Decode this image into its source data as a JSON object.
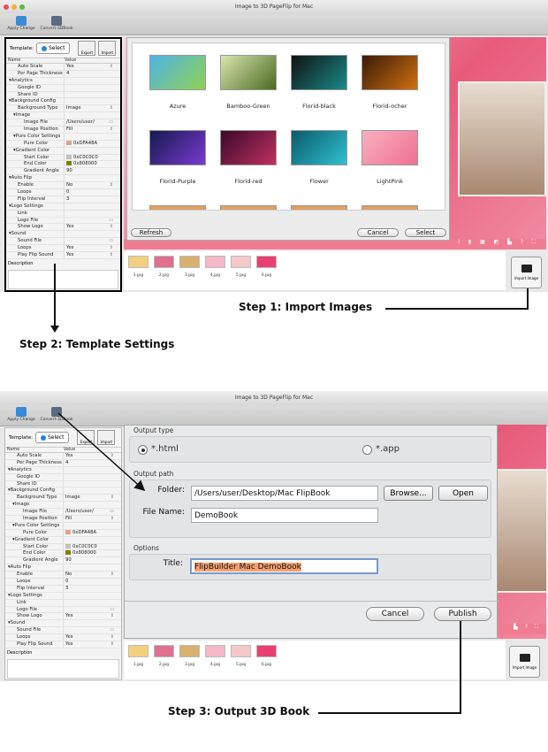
{
  "app": {
    "title": "Image to 3D PageFlip for Mac",
    "toolbar": {
      "apply": "Apply Change",
      "convert": "Convert-3DBook"
    }
  },
  "panel": {
    "template_label": "Template:",
    "select": "Select",
    "export": "Export",
    "import": "Import",
    "col_name": "Name",
    "col_value": "Value",
    "description": "Description",
    "rows": [
      {
        "n": "Auto Scale",
        "v": "Yes",
        "lvl": 2,
        "ctl": "dropdown"
      },
      {
        "n": "Per Page Thickness",
        "v": "4",
        "lvl": 2
      },
      {
        "n": "Analytics",
        "v": "",
        "lvl": 0,
        "group": true
      },
      {
        "n": "Google ID",
        "v": "",
        "lvl": 2
      },
      {
        "n": "Share ID",
        "v": "",
        "lvl": 2
      },
      {
        "n": "Background Config",
        "v": "",
        "lvl": 0,
        "group": true
      },
      {
        "n": "Background Type",
        "v": "Image",
        "lvl": 2,
        "ctl": "dropdown"
      },
      {
        "n": "Image",
        "v": "",
        "lvl": 1,
        "group": true
      },
      {
        "n": "Image File",
        "v": "/Users/user/",
        "lvl": 3,
        "ctl": "folder"
      },
      {
        "n": "Image Position",
        "v": "Fill",
        "lvl": 3,
        "ctl": "dropdown"
      },
      {
        "n": "Pure Color Settings",
        "v": "",
        "lvl": 1,
        "group": true
      },
      {
        "n": "Pure Color",
        "v": "0xDFA48A",
        "lvl": 3,
        "swatch": "#DFA48A"
      },
      {
        "n": "Gradient Color",
        "v": "",
        "lvl": 1,
        "group": true
      },
      {
        "n": "Start Color",
        "v": "0xC0C0C0",
        "lvl": 3,
        "swatch": "#C0C0C0"
      },
      {
        "n": "End Color",
        "v": "0x808000",
        "lvl": 3,
        "swatch": "#808000"
      },
      {
        "n": "Gradient Angle",
        "v": "90",
        "lvl": 3
      },
      {
        "n": "Auto Flip",
        "v": "",
        "lvl": 0,
        "group": true
      },
      {
        "n": "Enable",
        "v": "No",
        "lvl": 2,
        "ctl": "dropdown"
      },
      {
        "n": "Loops",
        "v": "0",
        "lvl": 2
      },
      {
        "n": "Flip Interval",
        "v": "3",
        "lvl": 2
      },
      {
        "n": "Logo Settings",
        "v": "",
        "lvl": 0,
        "group": true
      },
      {
        "n": "Link",
        "v": "",
        "lvl": 2
      },
      {
        "n": "Logo File",
        "v": "",
        "lvl": 2,
        "ctl": "folder"
      },
      {
        "n": "Show Logo",
        "v": "Yes",
        "lvl": 2,
        "ctl": "dropdown"
      },
      {
        "n": "Sound",
        "v": "",
        "lvl": 0,
        "group": true
      },
      {
        "n": "Sound File",
        "v": "",
        "lvl": 2,
        "ctl": "folder"
      },
      {
        "n": "Loops",
        "v": "Yes",
        "lvl": 2,
        "ctl": "dropdown"
      },
      {
        "n": "Play Flip Sound",
        "v": "Yes",
        "lvl": 2,
        "ctl": "dropdown"
      }
    ]
  },
  "templates": {
    "items": [
      {
        "name": "Azure",
        "c": [
          "#4fb3e8",
          "#8fd14f"
        ]
      },
      {
        "name": "Bamboo-Green",
        "c": [
          "#d8e6b0",
          "#4a6a20"
        ]
      },
      {
        "name": "Florid-black",
        "c": [
          "#111",
          "#1a8a8a"
        ]
      },
      {
        "name": "Florid-ocher",
        "c": [
          "#3a1a08",
          "#d07010"
        ]
      },
      {
        "name": "Florid-Purple",
        "c": [
          "#151a50",
          "#7a3ad0"
        ]
      },
      {
        "name": "Florid-red",
        "c": [
          "#3a0a2a",
          "#c03060"
        ]
      },
      {
        "name": "Flower",
        "c": [
          "#0a5a6a",
          "#30c0d0"
        ]
      },
      {
        "name": "LightPink",
        "c": [
          "#f8b0c0",
          "#f07090"
        ]
      }
    ],
    "refresh": "Refresh",
    "cancel": "Cancel",
    "select": "Select"
  },
  "thumbs": [
    "1.jpg",
    "2.jpg",
    "3.jpg",
    "4.jpg",
    "5.jpg",
    "6.jpg"
  ],
  "thumb_colors": [
    "#f3d080",
    "#e07090",
    "#d8b070",
    "#f4b8c8",
    "#f4c8c8",
    "#e84070"
  ],
  "import_image": "Import Image",
  "output": {
    "type_label": "Output type",
    "html": "*.html",
    "app": "*.app",
    "selected": "html",
    "path_label": "Output path",
    "folder_label": "Folder:",
    "folder": "/Users/user/Desktop/Mac FlipBook",
    "browse": "Browse...",
    "open": "Open",
    "filename_label": "File Name:",
    "filename": "DemoBook",
    "options_label": "Options",
    "title_label": "Title:",
    "title": "FlipBuilder Mac DemoBook",
    "cancel": "Cancel",
    "publish": "Publish"
  },
  "steps": {
    "s1": "Step 1: Import Images",
    "s2": "Step 2: Template Settings",
    "s3": "Step 3: Output 3D Book"
  },
  "colors": {
    "accent_pink": "#f07c92",
    "selection": "#f4a070"
  }
}
